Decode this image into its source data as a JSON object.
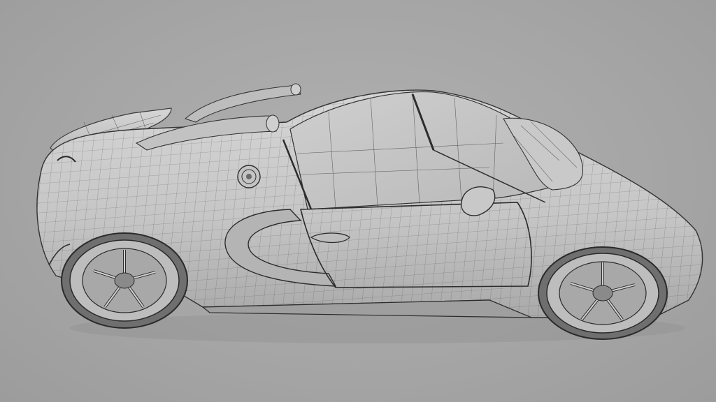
{
  "scene": {
    "subject": "car-wireframe-render",
    "background_color": "#a6a6a6",
    "body_color": "#c9c9c9",
    "wire_color": "#3a3a3a",
    "shadow_color": "#7f7f7f"
  }
}
